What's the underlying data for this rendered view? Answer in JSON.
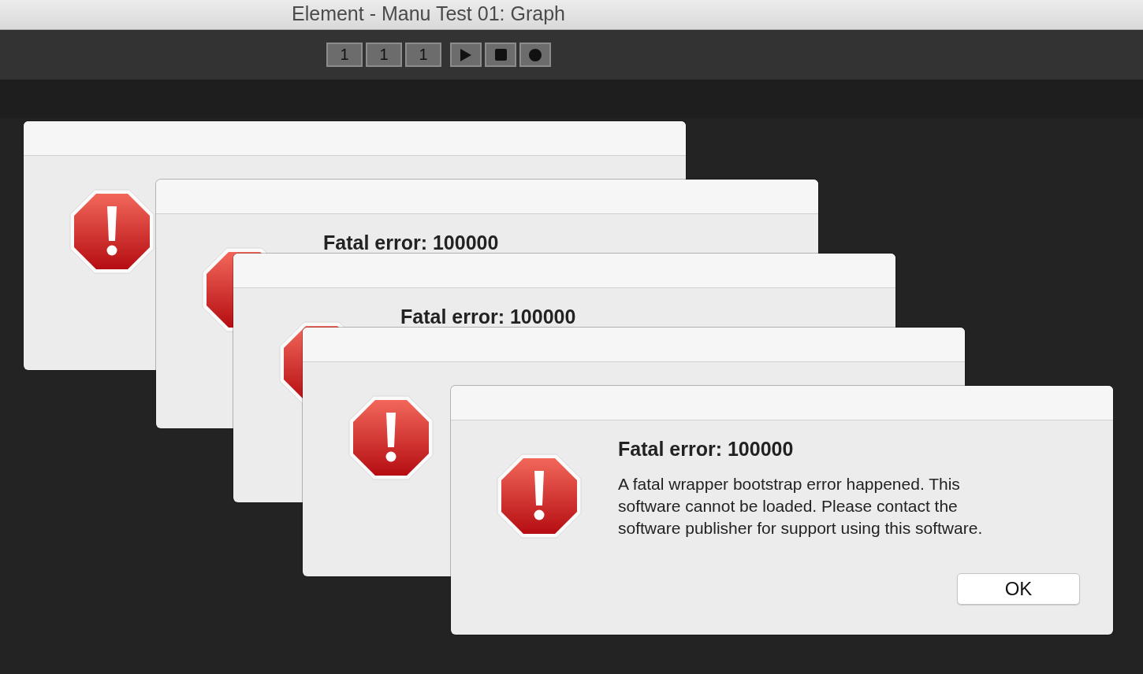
{
  "window": {
    "title": "Element - Manu Test 01: Graph"
  },
  "transport": [
    {
      "kind": "counter",
      "label": "1"
    },
    {
      "kind": "counter",
      "label": "1"
    },
    {
      "kind": "counter",
      "label": "1"
    },
    {
      "kind": "play"
    },
    {
      "kind": "stop"
    },
    {
      "kind": "record"
    }
  ],
  "dialogs": [
    {
      "kind": "error"
    },
    {
      "kind": "error",
      "heading": "Fatal error: 100000"
    },
    {
      "kind": "error",
      "heading": "Fatal error: 100000"
    },
    {
      "kind": "error"
    },
    {
      "kind": "error",
      "heading": "Fatal error: 100000",
      "message": "A fatal wrapper bootstrap error happened. This software cannot be loaded. Please contact the software publisher for support using this software.",
      "button": "OK"
    }
  ]
}
